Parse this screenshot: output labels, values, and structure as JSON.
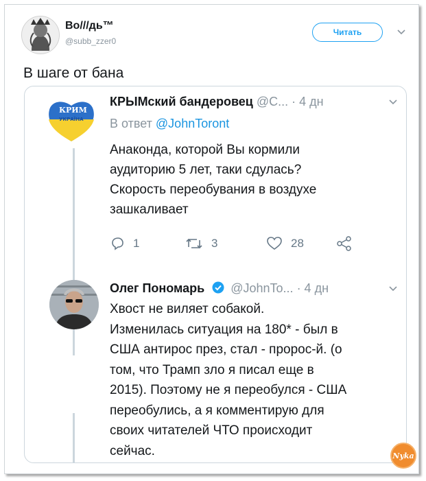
{
  "tweet": {
    "author_name": "Во///дь™",
    "author_handle": "@subb_zzer0",
    "follow_label": "Читать",
    "text": "В шаге от бана"
  },
  "quoted": [
    {
      "name": "КРЫМский бандеровец",
      "handle": "@С...",
      "time": "· 4 дн",
      "reply_prefix": "В ответ",
      "reply_to": "@JohnToront",
      "badge_line1": "КРИМ",
      "badge_line2": "УКРАЇНА",
      "body": "Анаконда, которой Вы кормили\nаудиторию 5 лет, таки сдулась?\nСкорость переобувания в воздухе\nзашкаливает",
      "replies": "1",
      "retweets": "3",
      "likes": "28"
    },
    {
      "name": "Олег Пономарь",
      "handle": "@JohnTo...",
      "time": "· 4 дн",
      "body": "Хвост не виляет собакой.\nИзменилась ситуация на 180* - был в\nСША антирос през, стал - пророс-й. (о\nтом, что Трамп зло я писал еще в\n2015). Поэтому не я переобулся - США\nпереобулись, а я комментирую для\nсвоих читателей ЧТО происходит\nсейчас."
    }
  ],
  "watermark": "Nyka",
  "colors": {
    "accent": "#1da1f2",
    "link": "#1b95e0",
    "muted": "#8a959e",
    "border": "#ccd6dd"
  }
}
